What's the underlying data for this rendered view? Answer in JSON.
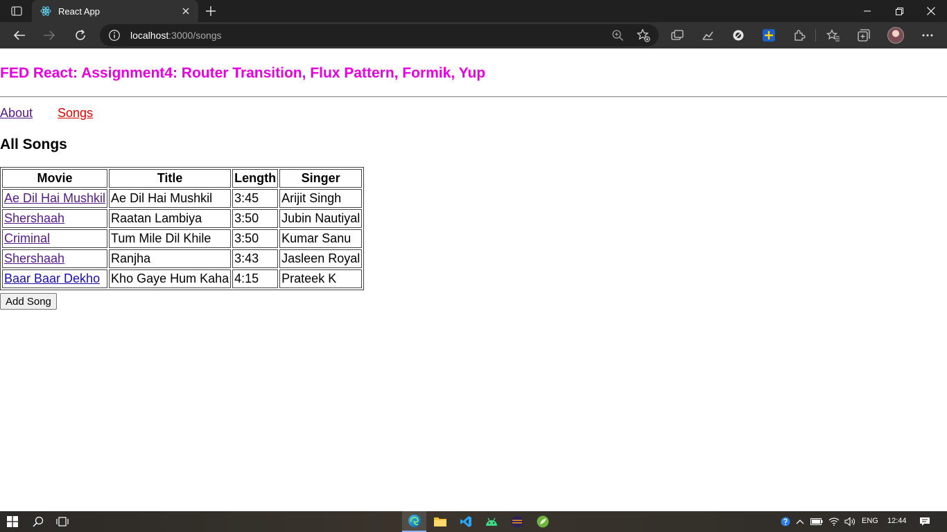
{
  "browser": {
    "tab_title": "React App",
    "url_host": "localhost",
    "url_path": ":3000/songs"
  },
  "app": {
    "header": "FED React: Assignment4: Router Transition, Flux Pattern, Formik, Yup",
    "nav": {
      "about": "About",
      "songs": "Songs"
    },
    "section_title": "All Songs",
    "table": {
      "headers": [
        "Movie",
        "Title",
        "Length",
        "Singer"
      ],
      "rows": [
        [
          "Ae Dil Hai Mushkil",
          "Ae Dil Hai Mushkil",
          "3:45",
          "Arijit Singh"
        ],
        [
          "Shershaah",
          "Raatan Lambiya",
          "3:50",
          "Jubin Nautiyal"
        ],
        [
          "Criminal",
          "Tum Mile Dil Khile",
          "3:50",
          "Kumar Sanu"
        ],
        [
          "Shershaah",
          "Ranjha",
          "3:43",
          "Jasleen Royal"
        ],
        [
          "Baar Baar Dekho",
          "Kho Gaye Hum Kaha",
          "4:15",
          "Prateek K"
        ]
      ]
    },
    "add_button": "Add Song"
  },
  "taskbar": {
    "language": "ENG",
    "time": "12:44"
  },
  "colors": {
    "header": "#e600dc",
    "nav_active": "#e30000",
    "link_visited": "#551a8b",
    "link": "#1a0dab"
  }
}
